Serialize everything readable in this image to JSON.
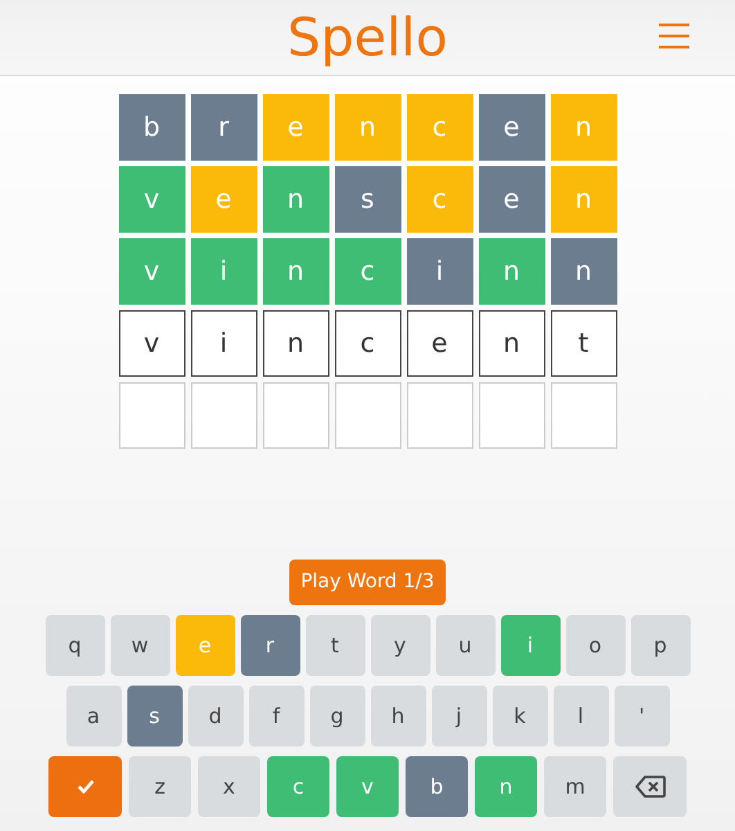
{
  "header": {
    "title": "Spello"
  },
  "board": [
    [
      {
        "letter": "b",
        "kind": "absent"
      },
      {
        "letter": "r",
        "kind": "absent"
      },
      {
        "letter": "e",
        "kind": "present"
      },
      {
        "letter": "n",
        "kind": "present"
      },
      {
        "letter": "c",
        "kind": "present"
      },
      {
        "letter": "e",
        "kind": "absent"
      },
      {
        "letter": "n",
        "kind": "present"
      }
    ],
    [
      {
        "letter": "v",
        "kind": "correct"
      },
      {
        "letter": "e",
        "kind": "present"
      },
      {
        "letter": "n",
        "kind": "correct"
      },
      {
        "letter": "s",
        "kind": "absent"
      },
      {
        "letter": "c",
        "kind": "present"
      },
      {
        "letter": "e",
        "kind": "absent"
      },
      {
        "letter": "n",
        "kind": "present"
      }
    ],
    [
      {
        "letter": "v",
        "kind": "correct"
      },
      {
        "letter": "i",
        "kind": "correct"
      },
      {
        "letter": "n",
        "kind": "correct"
      },
      {
        "letter": "c",
        "kind": "correct"
      },
      {
        "letter": "i",
        "kind": "absent"
      },
      {
        "letter": "n",
        "kind": "correct"
      },
      {
        "letter": "n",
        "kind": "absent"
      }
    ],
    [
      {
        "letter": "v",
        "kind": "typed"
      },
      {
        "letter": "i",
        "kind": "typed"
      },
      {
        "letter": "n",
        "kind": "typed"
      },
      {
        "letter": "c",
        "kind": "typed"
      },
      {
        "letter": "e",
        "kind": "typed"
      },
      {
        "letter": "n",
        "kind": "typed"
      },
      {
        "letter": "t",
        "kind": "typed"
      }
    ],
    [
      {
        "kind": "empty"
      },
      {
        "kind": "empty"
      },
      {
        "kind": "empty"
      },
      {
        "kind": "empty"
      },
      {
        "kind": "empty"
      },
      {
        "kind": "empty"
      },
      {
        "kind": "empty"
      }
    ]
  ],
  "play_button": "Play Word 1/3",
  "keyboard": [
    [
      {
        "kind": "unused",
        "label": "q"
      },
      {
        "kind": "unused",
        "label": "w"
      },
      {
        "kind": "present",
        "label": "e"
      },
      {
        "kind": "absent",
        "label": "r"
      },
      {
        "kind": "unused",
        "label": "t"
      },
      {
        "kind": "unused",
        "label": "y"
      },
      {
        "kind": "unused",
        "label": "u"
      },
      {
        "kind": "correct",
        "label": "i"
      },
      {
        "kind": "unused",
        "label": "o"
      },
      {
        "kind": "unused",
        "label": "p"
      }
    ],
    [
      {
        "kind": "unused",
        "label": "a"
      },
      {
        "kind": "absent",
        "label": "s"
      },
      {
        "kind": "unused",
        "label": "d"
      },
      {
        "kind": "unused",
        "label": "f"
      },
      {
        "kind": "unused",
        "label": "g"
      },
      {
        "kind": "unused",
        "label": "h"
      },
      {
        "kind": "unused",
        "label": "j"
      },
      {
        "kind": "unused",
        "label": "k"
      },
      {
        "kind": "unused",
        "label": "l"
      },
      {
        "kind": "unused",
        "label": "'"
      }
    ],
    [
      {
        "kind": "enter"
      },
      {
        "kind": "unused",
        "label": "z"
      },
      {
        "kind": "unused",
        "label": "x"
      },
      {
        "kind": "correct",
        "label": "c"
      },
      {
        "kind": "correct",
        "label": "v"
      },
      {
        "kind": "absent",
        "label": "b"
      },
      {
        "kind": "correct",
        "label": "n"
      },
      {
        "kind": "unused",
        "label": "m"
      },
      {
        "kind": "backspace"
      }
    ]
  ]
}
